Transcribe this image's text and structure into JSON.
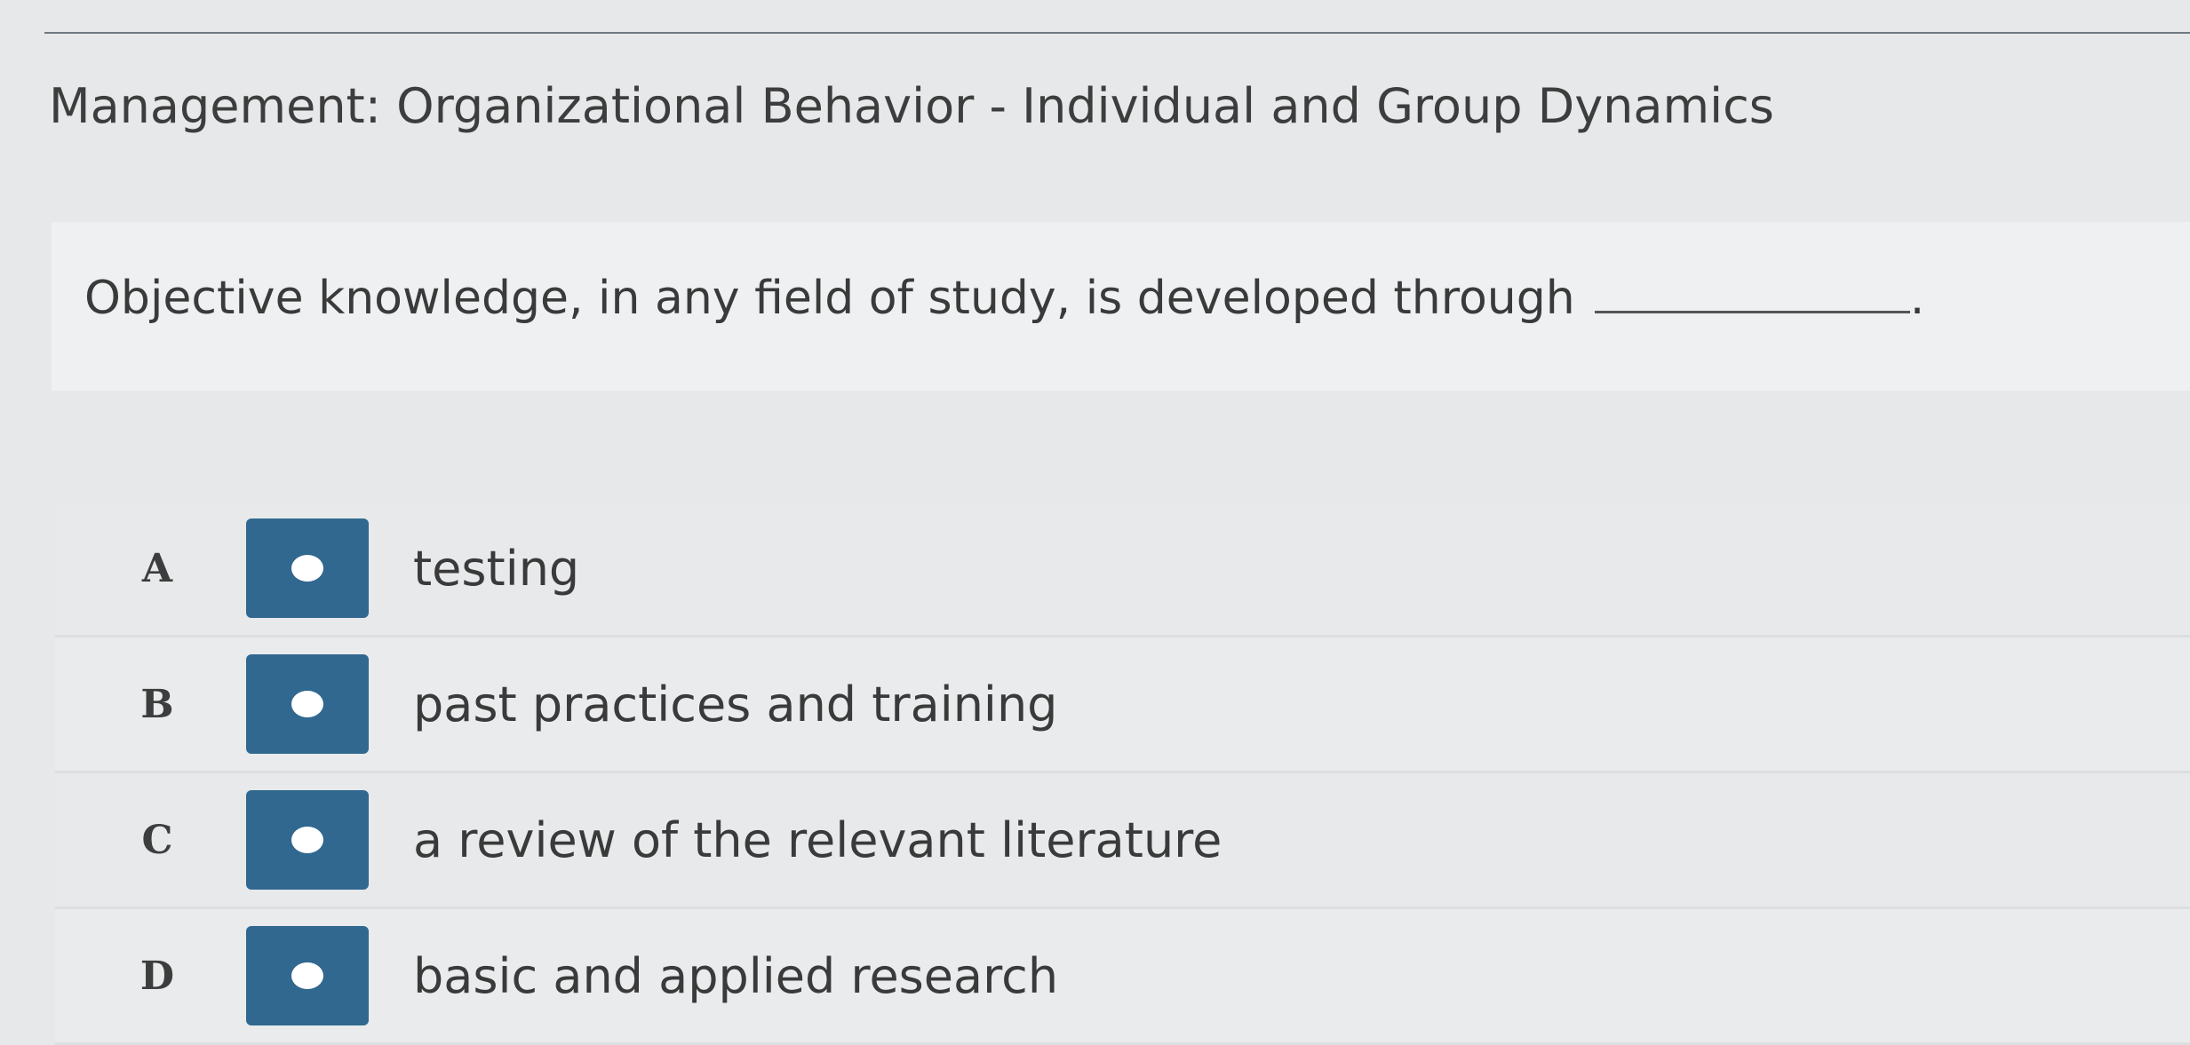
{
  "header": {
    "course_title": "Management: Organizational Behavior - Individual and Group Dynamics"
  },
  "question": {
    "text": "Objective knowledge, in any field of study, is developed through",
    "suffix": "."
  },
  "answers": [
    {
      "letter": "A",
      "text": "testing"
    },
    {
      "letter": "B",
      "text": "past practices and training"
    },
    {
      "letter": "C",
      "text": "a review of the relevant literature"
    },
    {
      "letter": "D",
      "text": "basic and applied research"
    }
  ],
  "colors": {
    "radio_button": "#31688f",
    "background": "#e6e8e9"
  }
}
